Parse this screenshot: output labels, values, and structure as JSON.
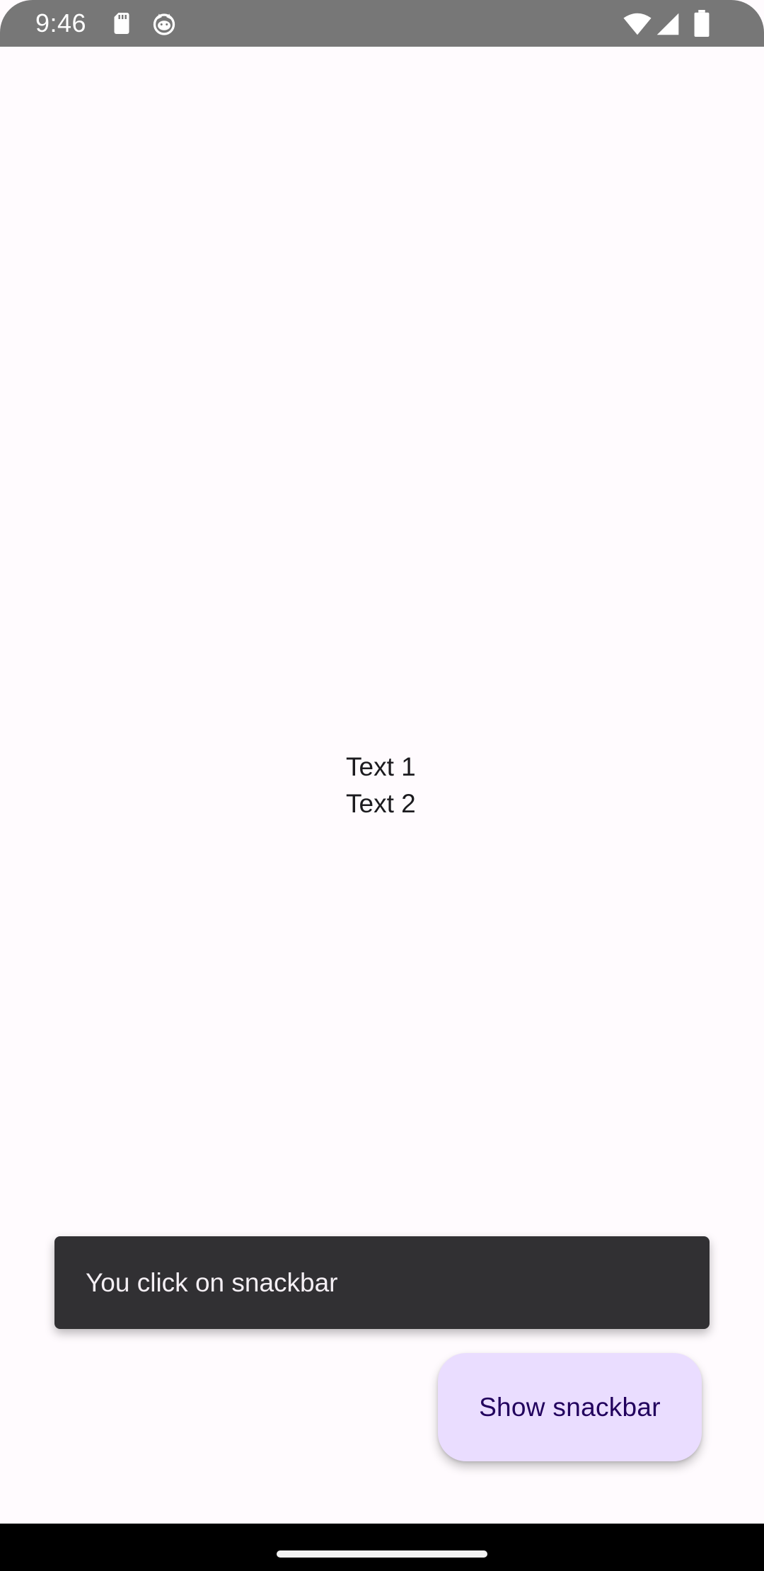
{
  "status_bar": {
    "time": "9:46",
    "icons": [
      "sd-card-icon",
      "cat-icon",
      "wifi-icon",
      "signal-icon",
      "battery-icon"
    ]
  },
  "main": {
    "text_1": "Text 1",
    "text_2": "Text 2"
  },
  "snackbar": {
    "message": "You click on snackbar"
  },
  "fab": {
    "label": "Show snackbar"
  },
  "colors": {
    "background": "#fffbfe",
    "status_bar": "#777777",
    "snackbar": "#313033",
    "fab_container": "#eaddff",
    "fab_text": "#21005d"
  }
}
